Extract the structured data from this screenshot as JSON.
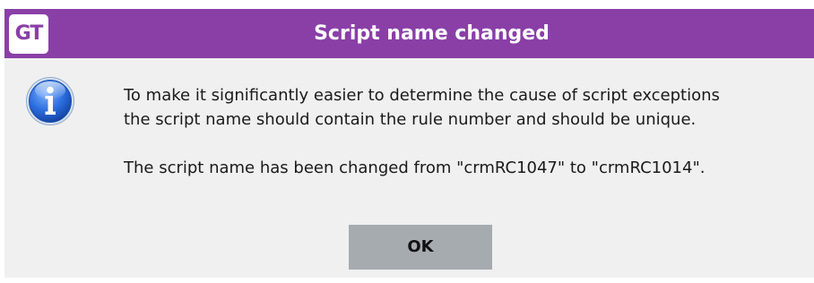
{
  "window": {
    "title": "Script name changed",
    "app_logo_text": "GT",
    "accent_color": "#8a3fa7"
  },
  "message": {
    "icon": "info-icon",
    "line1": "To make it significantly easier to determine the cause of script exceptions",
    "line2": "the script name should contain the rule number and should be unique.",
    "line3": "The script name has been changed from \"crmRC1047\" to \"crmRC1014\"."
  },
  "buttons": {
    "ok_label": "OK"
  }
}
